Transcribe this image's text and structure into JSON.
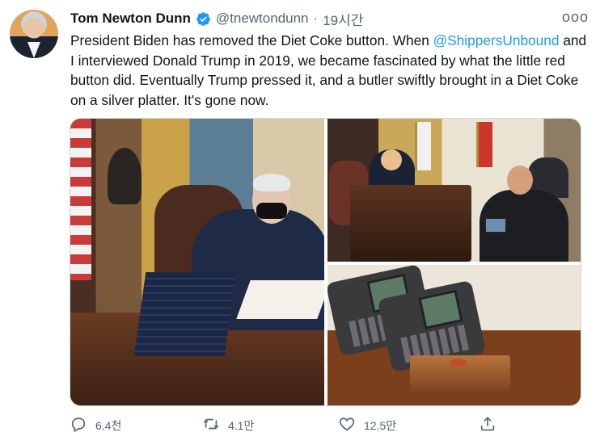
{
  "tweet": {
    "author_name": "Tom Newton Dunn",
    "handle": "@tnewtondunn",
    "separator": "·",
    "time": "19시간",
    "more_label": "ooo",
    "text_parts": {
      "line1": "President Biden has removed the Diet Coke button. When ",
      "mention": "@ShippersUnbound",
      "rest": " and I interviewed Donald Trump in 2019, we became fascinated by what the little red button did. Eventually Trump pressed it, and a butler swiftly brought in a Diet Coke on a silver platter. It's gone now."
    }
  },
  "actions": {
    "reply_count": "6.4천",
    "retweet_count": "4.1만",
    "like_count": "12.5만",
    "icons": {
      "reply": "reply-bubble-icon",
      "retweet": "retweet-arrows-icon",
      "like": "heart-outline-icon",
      "share": "share-upload-icon",
      "verified": "verified-badge-icon"
    }
  },
  "colors": {
    "accent": "#1d9bf0",
    "secondary_text": "#536471",
    "primary_text": "#0f1419"
  }
}
